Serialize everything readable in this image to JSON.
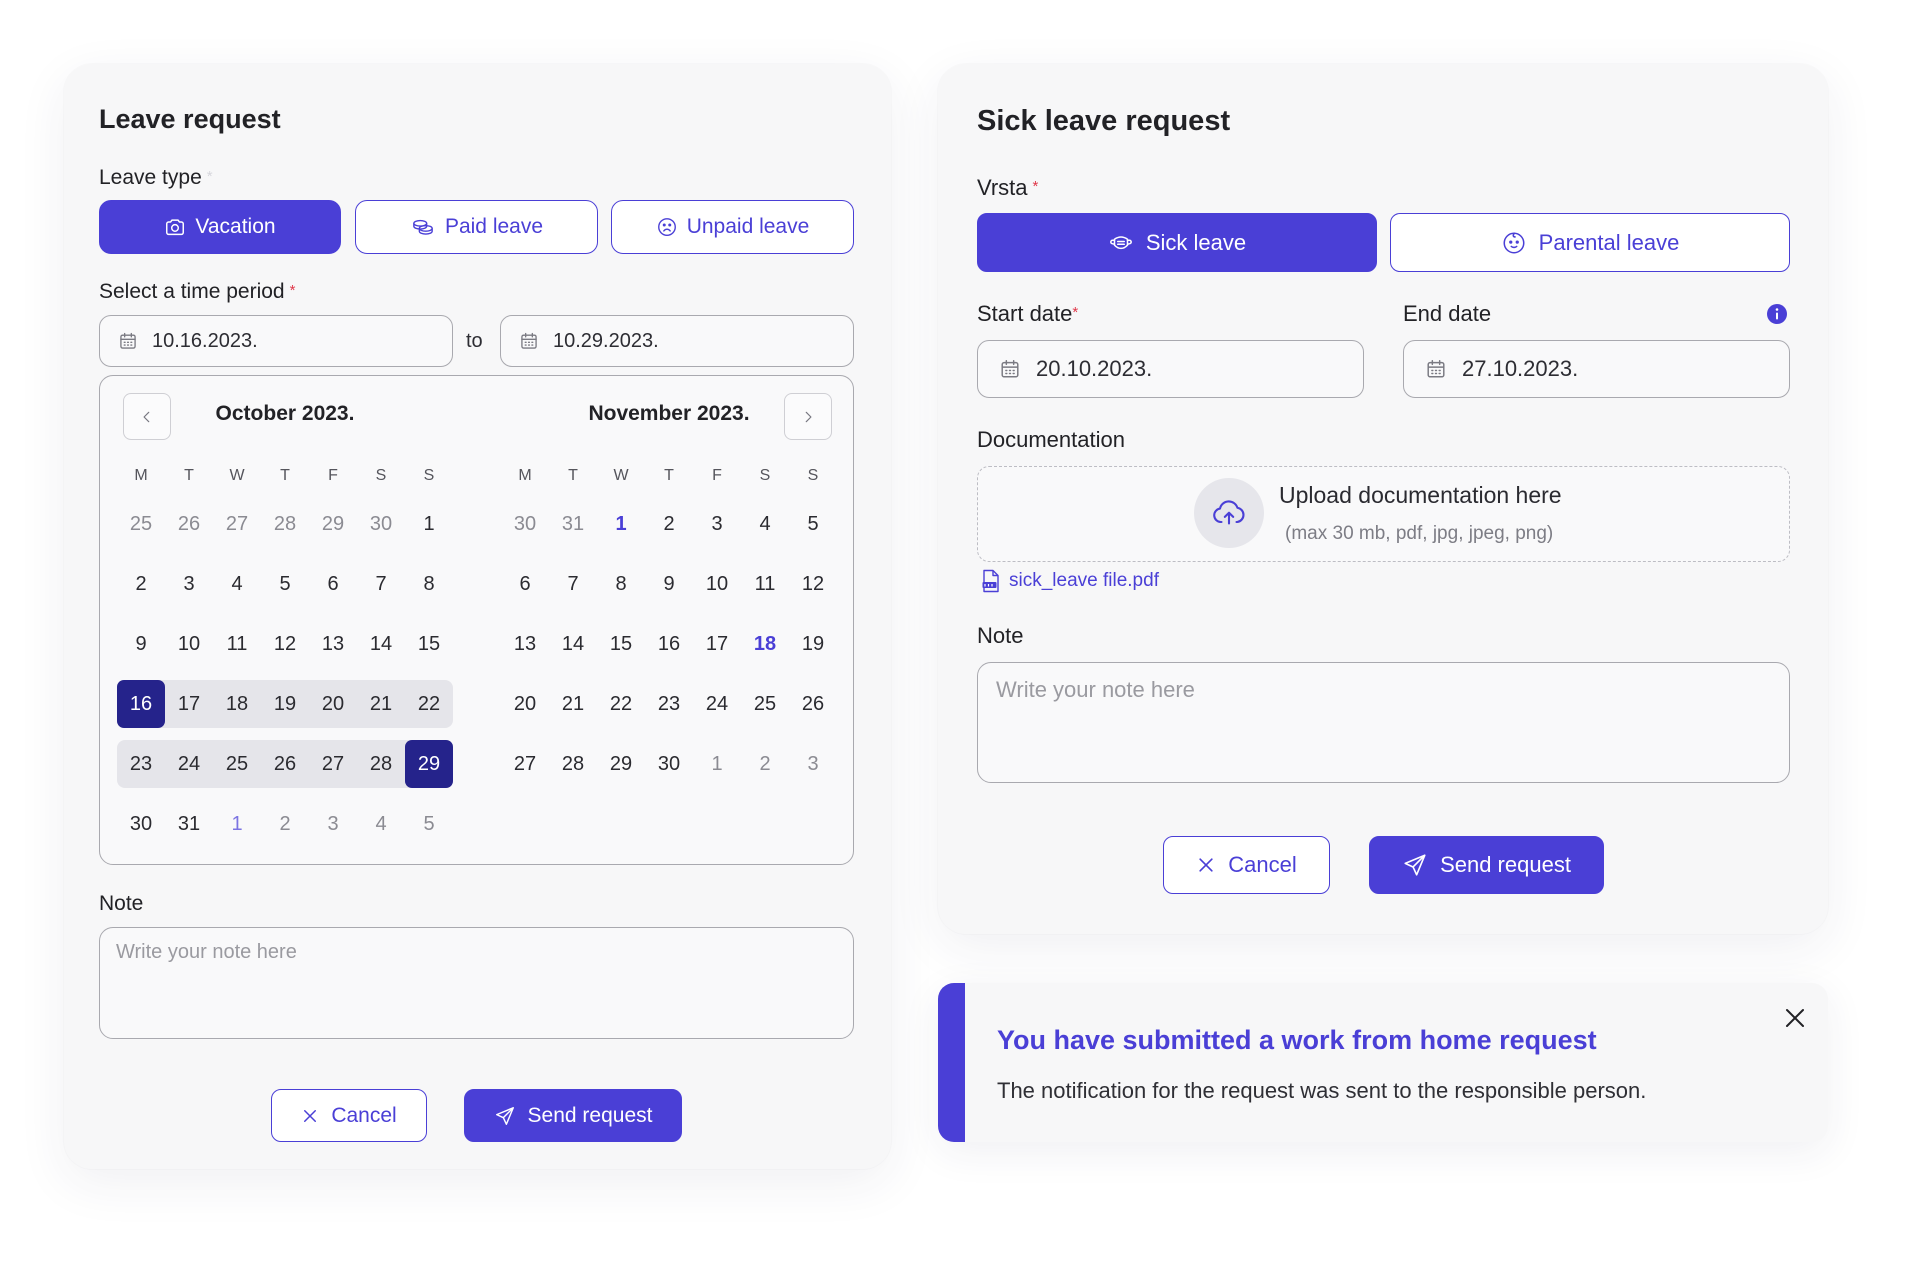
{
  "colors": {
    "primary": "#4a3fd6",
    "selected_day": "#25238b",
    "range_background": "#e5e5ea",
    "required": "#e0384a"
  },
  "leave_card": {
    "title": "Leave request",
    "leave_type_label": "Leave type",
    "required_mark": "*",
    "leave_types": [
      {
        "label": "Vacation",
        "icon": "camera-icon",
        "selected": true
      },
      {
        "label": "Paid leave",
        "icon": "coins-icon",
        "selected": false
      },
      {
        "label": "Unpaid leave",
        "icon": "sad-face-icon",
        "selected": false
      }
    ],
    "period_label": "Select a time period",
    "start_date": "10.16.2023.",
    "to_label": "to",
    "end_date": "10.29.2023.",
    "calendar": {
      "prev_icon": "chevron-left-icon",
      "next_icon": "chevron-right-icon",
      "months": [
        {
          "title": "October 2023.",
          "weekdays": [
            "M",
            "T",
            "W",
            "T",
            "F",
            "S",
            "S"
          ],
          "weeks": [
            [
              {
                "d": "25",
                "state": "muted"
              },
              {
                "d": "26",
                "state": "muted"
              },
              {
                "d": "27",
                "state": "muted"
              },
              {
                "d": "28",
                "state": "muted"
              },
              {
                "d": "29",
                "state": "muted"
              },
              {
                "d": "30",
                "state": "muted"
              },
              {
                "d": "1",
                "state": "default"
              }
            ],
            [
              {
                "d": "2",
                "state": "default"
              },
              {
                "d": "3",
                "state": "default"
              },
              {
                "d": "4",
                "state": "default"
              },
              {
                "d": "5",
                "state": "default"
              },
              {
                "d": "6",
                "state": "default"
              },
              {
                "d": "7",
                "state": "default"
              },
              {
                "d": "8",
                "state": "default"
              }
            ],
            [
              {
                "d": "9",
                "state": "default"
              },
              {
                "d": "10",
                "state": "default"
              },
              {
                "d": "11",
                "state": "default"
              },
              {
                "d": "12",
                "state": "default"
              },
              {
                "d": "13",
                "state": "default"
              },
              {
                "d": "14",
                "state": "default"
              },
              {
                "d": "15",
                "state": "default"
              }
            ],
            [
              {
                "d": "16",
                "state": "selected-start"
              },
              {
                "d": "17",
                "state": "range"
              },
              {
                "d": "18",
                "state": "range"
              },
              {
                "d": "19",
                "state": "range"
              },
              {
                "d": "20",
                "state": "range"
              },
              {
                "d": "21",
                "state": "range"
              },
              {
                "d": "22",
                "state": "range-end"
              }
            ],
            [
              {
                "d": "23",
                "state": "range-start"
              },
              {
                "d": "24",
                "state": "range"
              },
              {
                "d": "25",
                "state": "range"
              },
              {
                "d": "26",
                "state": "range"
              },
              {
                "d": "27",
                "state": "range"
              },
              {
                "d": "28",
                "state": "range"
              },
              {
                "d": "29",
                "state": "selected-end"
              }
            ],
            [
              {
                "d": "30",
                "state": "default"
              },
              {
                "d": "31",
                "state": "default"
              },
              {
                "d": "1",
                "state": "accent-muted"
              },
              {
                "d": "2",
                "state": "muted"
              },
              {
                "d": "3",
                "state": "muted"
              },
              {
                "d": "4",
                "state": "muted"
              },
              {
                "d": "5",
                "state": "muted"
              }
            ]
          ]
        },
        {
          "title": "November 2023.",
          "weekdays": [
            "M",
            "T",
            "W",
            "T",
            "F",
            "S",
            "S"
          ],
          "weeks": [
            [
              {
                "d": "30",
                "state": "muted"
              },
              {
                "d": "31",
                "state": "muted"
              },
              {
                "d": "1",
                "state": "accent"
              },
              {
                "d": "2",
                "state": "default"
              },
              {
                "d": "3",
                "state": "default"
              },
              {
                "d": "4",
                "state": "default"
              },
              {
                "d": "5",
                "state": "default"
              }
            ],
            [
              {
                "d": "6",
                "state": "default"
              },
              {
                "d": "7",
                "state": "default"
              },
              {
                "d": "8",
                "state": "default"
              },
              {
                "d": "9",
                "state": "default"
              },
              {
                "d": "10",
                "state": "default"
              },
              {
                "d": "11",
                "state": "default"
              },
              {
                "d": "12",
                "state": "default"
              }
            ],
            [
              {
                "d": "13",
                "state": "default"
              },
              {
                "d": "14",
                "state": "default"
              },
              {
                "d": "15",
                "state": "default"
              },
              {
                "d": "16",
                "state": "default"
              },
              {
                "d": "17",
                "state": "default"
              },
              {
                "d": "18",
                "state": "accent"
              },
              {
                "d": "19",
                "state": "default"
              }
            ],
            [
              {
                "d": "20",
                "state": "default"
              },
              {
                "d": "21",
                "state": "default"
              },
              {
                "d": "22",
                "state": "default"
              },
              {
                "d": "23",
                "state": "default"
              },
              {
                "d": "24",
                "state": "default"
              },
              {
                "d": "25",
                "state": "default"
              },
              {
                "d": "26",
                "state": "default"
              }
            ],
            [
              {
                "d": "27",
                "state": "default"
              },
              {
                "d": "28",
                "state": "default"
              },
              {
                "d": "29",
                "state": "default"
              },
              {
                "d": "30",
                "state": "default"
              },
              {
                "d": "1",
                "state": "muted"
              },
              {
                "d": "2",
                "state": "muted"
              },
              {
                "d": "3",
                "state": "muted"
              }
            ]
          ]
        }
      ]
    },
    "note_label": "Note",
    "note_placeholder": "Write your note here",
    "cancel_label": "Cancel",
    "send_label": "Send request"
  },
  "sick_card": {
    "title": "Sick leave request",
    "type_label": "Vrsta",
    "required_mark": "*",
    "types": [
      {
        "label": "Sick leave",
        "icon": "mask-icon",
        "selected": true
      },
      {
        "label": "Parental leave",
        "icon": "baby-face-icon",
        "selected": false
      }
    ],
    "start_label": "Start date",
    "end_label": "End date",
    "start_date": "20.10.2023.",
    "end_date": "27.10.2023.",
    "documentation_label": "Documentation",
    "upload_title": "Upload documentation here",
    "upload_hint": "(max 30 mb, pdf, jpg, jpeg, png)",
    "attached_file": "sick_leave file.pdf",
    "note_label": "Note",
    "note_placeholder": "Write your note here",
    "cancel_label": "Cancel",
    "send_label": "Send request"
  },
  "notification": {
    "title": "You have submitted a work from home request",
    "message": "The notification for the request was sent to the responsible person."
  }
}
